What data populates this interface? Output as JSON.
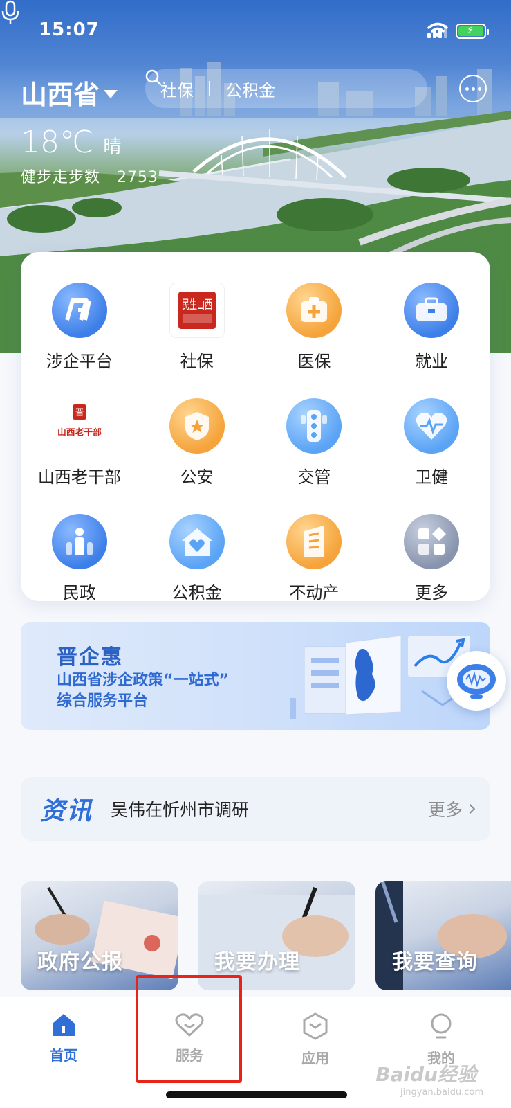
{
  "status_bar": {
    "time": "15:07"
  },
  "header": {
    "province": "山西省",
    "search": {
      "term1": "社保",
      "term2": "公积金"
    }
  },
  "weather": {
    "temperature": "18℃",
    "condition": "晴"
  },
  "steps": {
    "label": "健步走步数",
    "count": "2753"
  },
  "services": [
    {
      "label": "涉企平台",
      "icon": "enterprise-platform-icon"
    },
    {
      "label": "社保",
      "icon": "social-security-logo-icon",
      "logo_text": "民生山西"
    },
    {
      "label": "医保",
      "icon": "medical-insurance-icon"
    },
    {
      "label": "就业",
      "icon": "employment-briefcase-icon"
    },
    {
      "label": "山西老干部",
      "icon": "veteran-cadre-logo-icon",
      "logo_text": "山西老干部"
    },
    {
      "label": "公安",
      "icon": "police-badge-icon"
    },
    {
      "label": "交管",
      "icon": "traffic-light-icon"
    },
    {
      "label": "卫健",
      "icon": "health-heart-icon"
    },
    {
      "label": "民政",
      "icon": "civil-affairs-icon"
    },
    {
      "label": "公积金",
      "icon": "housing-fund-icon"
    },
    {
      "label": "不动产",
      "icon": "real-estate-icon"
    },
    {
      "label": "更多",
      "icon": "more-grid-icon"
    }
  ],
  "banner": {
    "title": "晋企惠",
    "subtitle_line1": "山西省涉企政策“一站式”",
    "subtitle_line2": "综合服务平台"
  },
  "news": {
    "tag": "资讯",
    "headline": "吴伟在忻州市调研",
    "more": "更多"
  },
  "photo_cards": [
    {
      "label": "政府公报"
    },
    {
      "label": "我要办理"
    },
    {
      "label": "我要查询"
    }
  ],
  "tabs": [
    {
      "label": "首页",
      "active": true
    },
    {
      "label": "服务",
      "active": false
    },
    {
      "label": "应用",
      "active": false
    },
    {
      "label": "我的",
      "active": false
    }
  ],
  "watermark": {
    "brand": "Baidu经验",
    "url": "jingyan.baidu.com"
  },
  "colors": {
    "accent": "#2f6fd7",
    "highlight": "#e8231a",
    "tab_inactive": "#a9a9a9"
  }
}
